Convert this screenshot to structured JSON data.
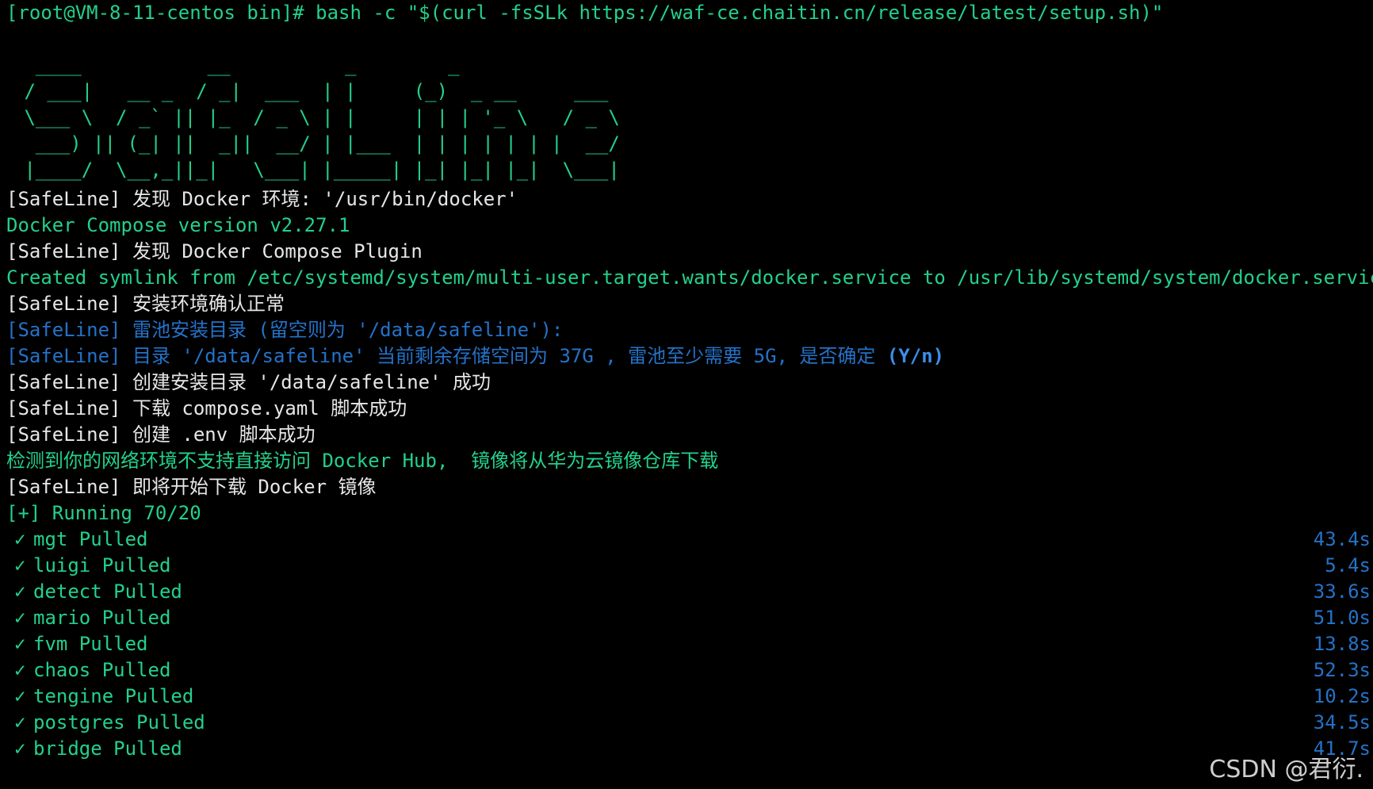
{
  "prompt_command": "[root@VM-8-11-centos bin]# bash -c \"$(curl -fsSLk https://waf-ce.chaitin.cn/release/latest/setup.sh)\"",
  "banner_ascii": "  ____           __          _        _\n / ___|   __ _  / _|  ___  | |     (_)  _ __     ___\n \\___ \\  / _` || |_  / _ \\ | |     | | | '_ \\   / _ \\\n  ___) || (_| ||  _||  __/ | |___  | | | | | | |  __/\n |____/  \\__,_||_|   \\___| |_____| |_| |_| |_|  \\___|",
  "log": {
    "l1": "[SafeLine] 发现 Docker 环境: '/usr/bin/docker'",
    "l2": "Docker Compose version v2.27.1",
    "l3": "[SafeLine] 发现 Docker Compose Plugin",
    "l4": "Created symlink from /etc/systemd/system/multi-user.target.wants/docker.service to /usr/lib/systemd/system/docker.service.",
    "l5": "[SafeLine] 安装环境确认正常",
    "l6": "[SafeLine] 雷池安装目录 (留空则为 '/data/safeline'):",
    "l7_text": "[SafeLine] 目录 '/data/safeline' 当前剩余存储空间为 37G , 雷池至少需要 5G, 是否确定 ",
    "l7_yn": "(Y/n)",
    "l8": "[SafeLine] 创建安装目录 '/data/safeline' 成功",
    "l9": "[SafeLine] 下载 compose.yaml 脚本成功",
    "l10": "[SafeLine] 创建 .env 脚本成功",
    "l11": "检测到你的网络环境不支持直接访问 Docker Hub,  镜像将从华为云镜像仓库下载",
    "l12": "[SafeLine] 即将开始下载 Docker 镜像",
    "running": "[+] Running 70/20"
  },
  "check_glyph": "✓",
  "pulled": [
    {
      "name": "mgt Pulled",
      "time": "43.4s"
    },
    {
      "name": "luigi Pulled",
      "time": "5.4s"
    },
    {
      "name": "detect Pulled",
      "time": "33.6s"
    },
    {
      "name": "mario Pulled",
      "time": "51.0s"
    },
    {
      "name": "fvm Pulled",
      "time": "13.8s"
    },
    {
      "name": "chaos Pulled",
      "time": "52.3s"
    },
    {
      "name": "tengine Pulled",
      "time": "10.2s"
    },
    {
      "name": "postgres Pulled",
      "time": "34.5s"
    },
    {
      "name": "bridge Pulled",
      "time": "41.7s"
    }
  ],
  "watermark": "CSDN @君衍.",
  "colors": {
    "background": "#000000",
    "green": "#23d18b",
    "blue": "#2472c8",
    "white": "#e6e6e6"
  }
}
